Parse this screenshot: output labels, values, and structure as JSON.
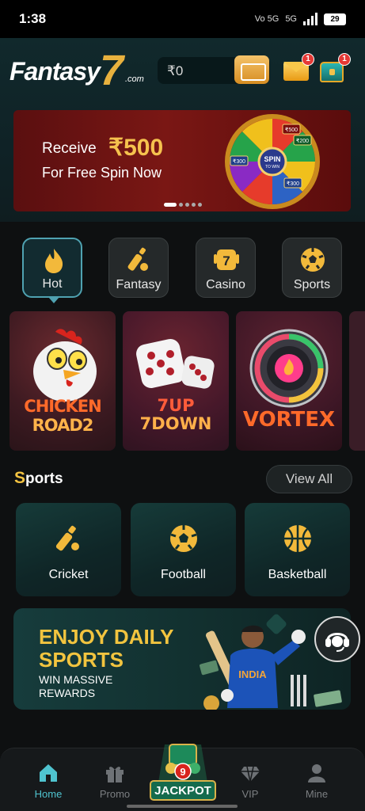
{
  "status_bar": {
    "time": "1:38",
    "network": "5G",
    "volte": "Vo 5G",
    "battery": "29"
  },
  "header": {
    "logo_word": "Fantasy",
    "logo_seven": "7",
    "logo_suffix": ".com",
    "balance": "₹0",
    "mail_badge": "1",
    "chest_badge": "1"
  },
  "banner": {
    "line1": "Receive",
    "amount": "₹500",
    "line2": "For Free Spin Now",
    "wheel_center_top": "SPIN",
    "wheel_center_mid": "TO WIN",
    "wheel_prizes": [
      "₹500",
      "₹200",
      "₹300",
      "₹300"
    ]
  },
  "categories": [
    {
      "label": "Hot",
      "icon": "flame-icon",
      "active": true
    },
    {
      "label": "Fantasy",
      "icon": "cricket-bat-icon",
      "active": false
    },
    {
      "label": "Casino",
      "icon": "slot-seven-icon",
      "active": false
    },
    {
      "label": "Sports",
      "icon": "soccer-ball-icon",
      "active": false
    }
  ],
  "games": [
    {
      "title_line1": "CHICKEN",
      "title_line2": "ROAD2"
    },
    {
      "title_line1": "7UP",
      "title_line2": "7DOWN"
    },
    {
      "title_line1": "VORTEX",
      "title_line2": ""
    }
  ],
  "sports_section": {
    "title_cap": "S",
    "title_rest": "ports",
    "view_all": "View All",
    "items": [
      {
        "label": "Cricket",
        "icon": "cricket-bat-icon"
      },
      {
        "label": "Football",
        "icon": "soccer-ball-icon"
      },
      {
        "label": "Basketball",
        "icon": "basketball-icon"
      }
    ]
  },
  "promo": {
    "headline1": "ENJOY DAILY",
    "headline2": "SPORTS",
    "sub1": "WIN MASSIVE",
    "sub2": "REWARDS",
    "jersey": "INDIA"
  },
  "nav": {
    "items": [
      {
        "label": "Home",
        "icon": "home-icon",
        "active": true
      },
      {
        "label": "Promo",
        "icon": "gift-icon",
        "active": false
      },
      {
        "label": "JACKPOT",
        "icon": "jackpot-icon",
        "active": false
      },
      {
        "label": "VIP",
        "icon": "diamond-icon",
        "active": false
      },
      {
        "label": "Mine",
        "icon": "user-icon",
        "active": false
      }
    ],
    "jackpot_ball": "9"
  },
  "colors": {
    "accent_gold": "#f3c341",
    "accent_teal": "#4fc3cf",
    "banner_red": "#7a1714"
  }
}
